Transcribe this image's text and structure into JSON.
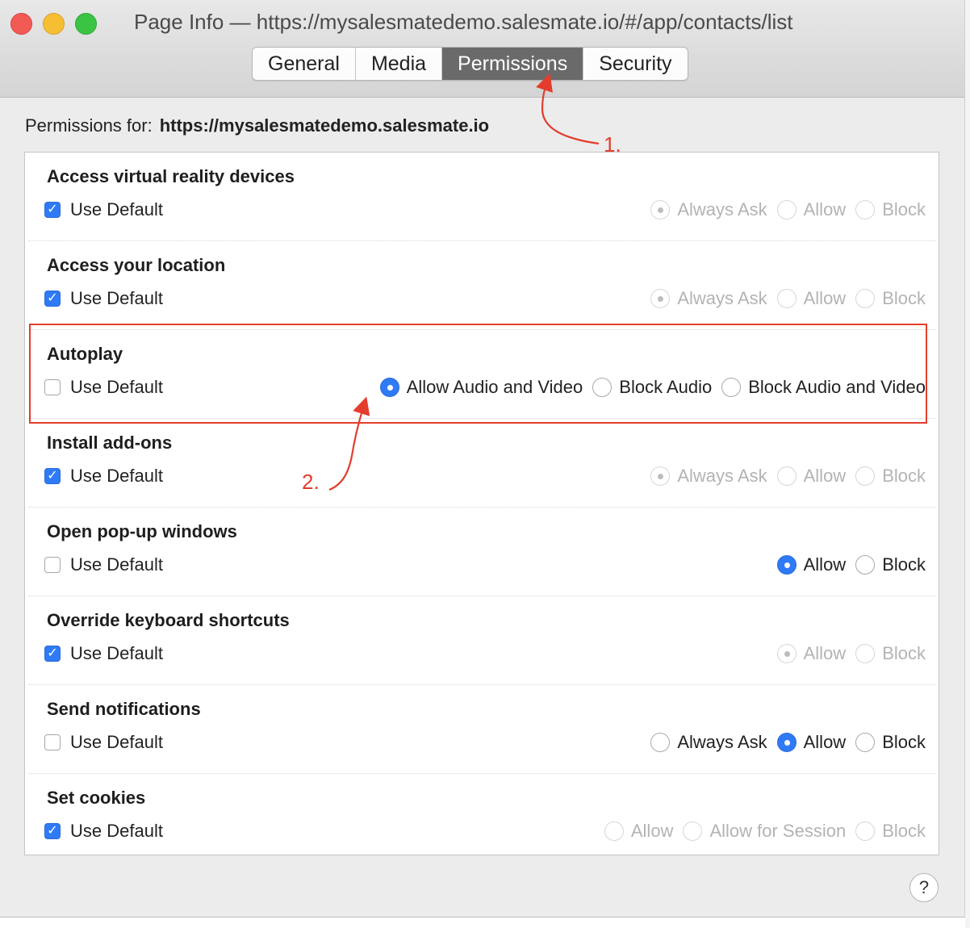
{
  "window": {
    "title": "Page Info — https://mysalesmatedemo.salesmate.io/#/app/contacts/list"
  },
  "tabs": [
    {
      "label": "General",
      "active": false
    },
    {
      "label": "Media",
      "active": false
    },
    {
      "label": "Permissions",
      "active": true
    },
    {
      "label": "Security",
      "active": false
    }
  ],
  "permissions_for": {
    "label": "Permissions for:",
    "site": "https://mysalesmatedemo.salesmate.io"
  },
  "use_default_label": "Use Default",
  "rows": [
    {
      "title": "Access virtual reality devices",
      "use_default": true,
      "enabled": false,
      "options": [
        {
          "label": "Always Ask",
          "selected": true
        },
        {
          "label": "Allow",
          "selected": false
        },
        {
          "label": "Block",
          "selected": false
        }
      ]
    },
    {
      "title": "Access your location",
      "use_default": true,
      "enabled": false,
      "options": [
        {
          "label": "Always Ask",
          "selected": true
        },
        {
          "label": "Allow",
          "selected": false
        },
        {
          "label": "Block",
          "selected": false
        }
      ]
    },
    {
      "title": "Autoplay",
      "use_default": false,
      "enabled": true,
      "options": [
        {
          "label": "Allow Audio and Video",
          "selected": true
        },
        {
          "label": "Block Audio",
          "selected": false
        },
        {
          "label": "Block Audio and Video",
          "selected": false
        }
      ]
    },
    {
      "title": "Install add-ons",
      "use_default": true,
      "enabled": false,
      "options": [
        {
          "label": "Always Ask",
          "selected": true
        },
        {
          "label": "Allow",
          "selected": false
        },
        {
          "label": "Block",
          "selected": false
        }
      ]
    },
    {
      "title": "Open pop-up windows",
      "use_default": false,
      "enabled": true,
      "options": [
        {
          "label": "Allow",
          "selected": true
        },
        {
          "label": "Block",
          "selected": false
        }
      ]
    },
    {
      "title": "Override keyboard shortcuts",
      "use_default": true,
      "enabled": false,
      "options": [
        {
          "label": "Allow",
          "selected": true
        },
        {
          "label": "Block",
          "selected": false
        }
      ]
    },
    {
      "title": "Send notifications",
      "use_default": false,
      "enabled": true,
      "options": [
        {
          "label": "Always Ask",
          "selected": false
        },
        {
          "label": "Allow",
          "selected": true
        },
        {
          "label": "Block",
          "selected": false
        }
      ]
    },
    {
      "title": "Set cookies",
      "use_default": true,
      "enabled": false,
      "options": [
        {
          "label": "Allow",
          "selected": false
        },
        {
          "label": "Allow for Session",
          "selected": false
        },
        {
          "label": "Block",
          "selected": false
        }
      ]
    }
  ],
  "help_label": "?",
  "annotations": {
    "step1": "1.",
    "step2": "2.",
    "color": "#e43d2d"
  },
  "colors": {
    "accent": "#2f7af6",
    "active_tab": "#6a6a6a"
  }
}
